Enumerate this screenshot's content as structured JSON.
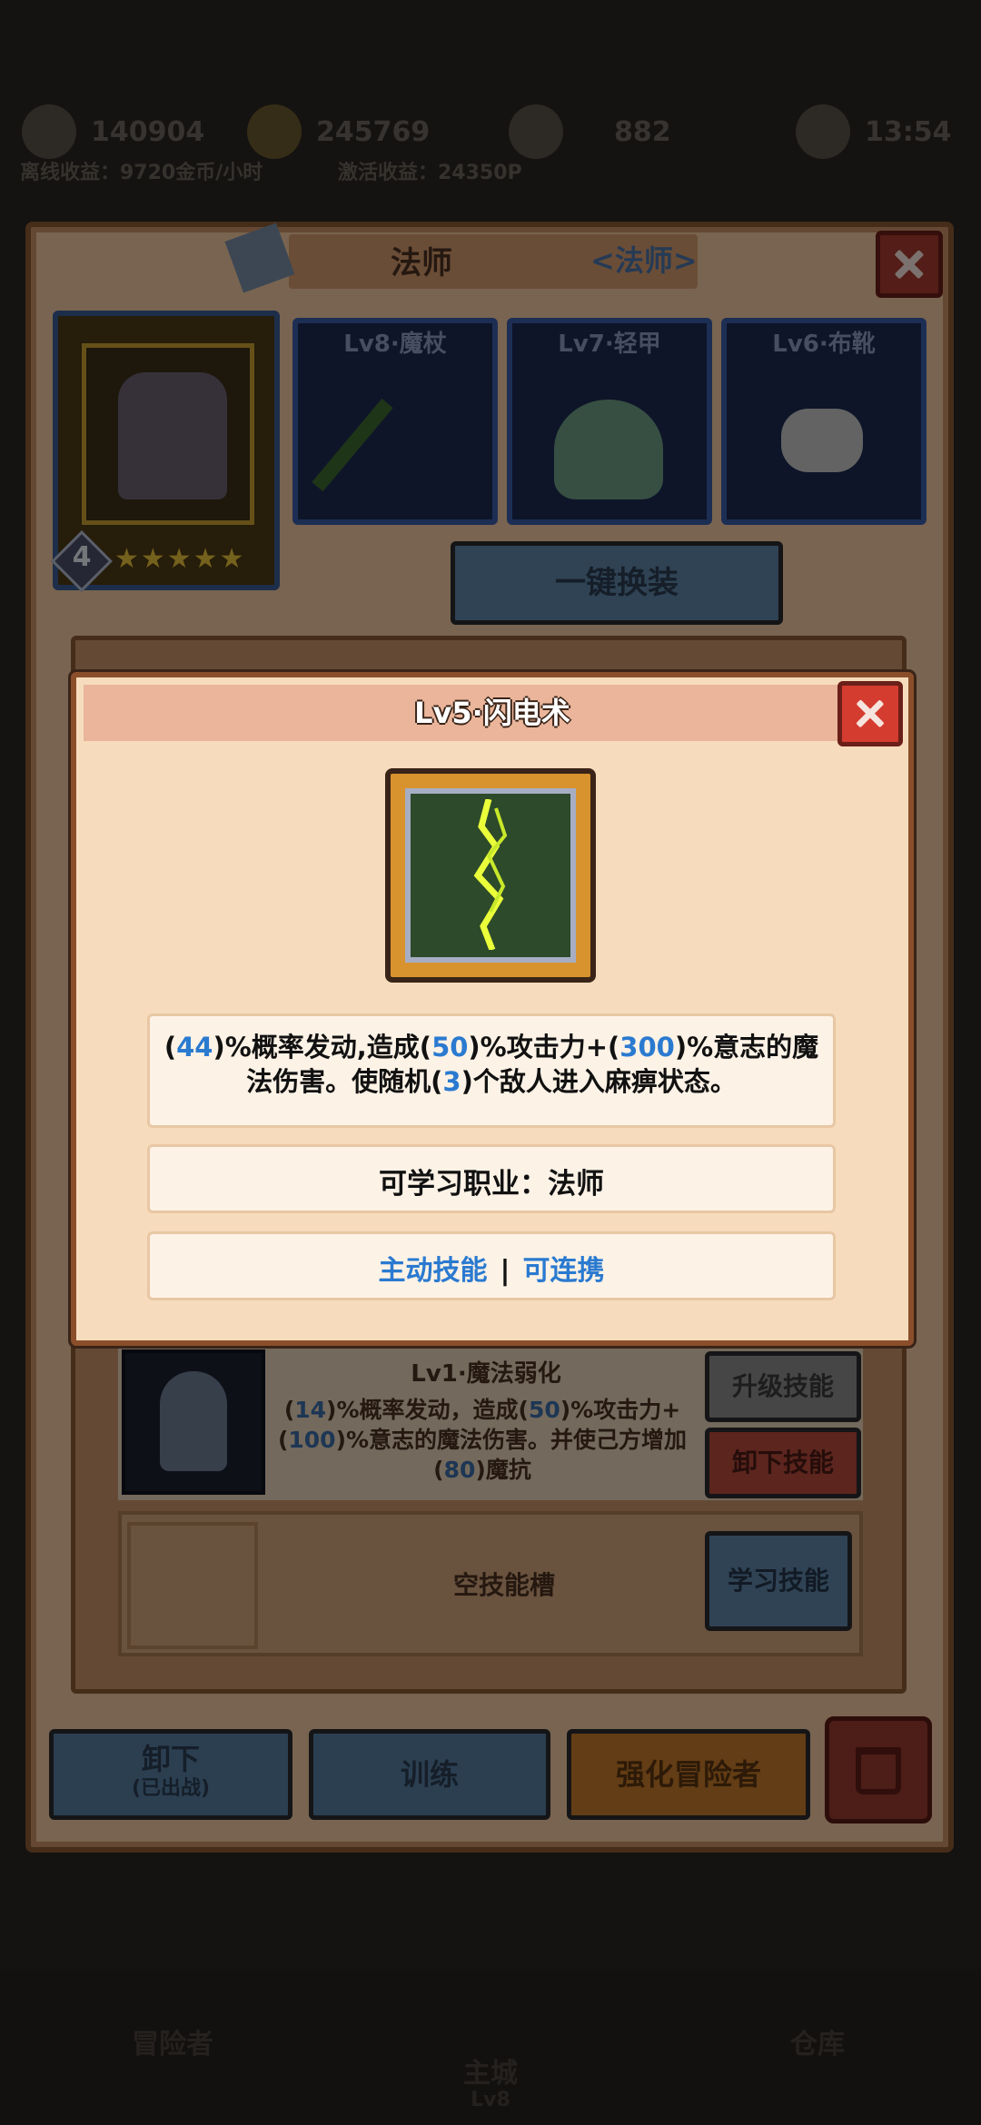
{
  "topbar": {
    "res1_value": "140904",
    "gold_value": "245769",
    "gem_value": "882",
    "time_value": "13:54",
    "income_left": "离线收益：9720金币/小时",
    "income_right": "激活收益：24350P"
  },
  "hero": {
    "name": "法师",
    "class_label": "<法师>",
    "level": "4",
    "stars": "★★★★★"
  },
  "equipment": [
    {
      "label": "Lv8·魔杖",
      "icon": "staff-icon"
    },
    {
      "label": "Lv7·轻甲",
      "icon": "light-armor-icon"
    },
    {
      "label": "Lv6·布靴",
      "icon": "cloth-boots-icon"
    }
  ],
  "buttons": {
    "equip_all": "一键换装",
    "upgrade_skill": "升级技能",
    "remove_skill": "卸下技能",
    "learn_skill": "学习技能",
    "unequip": "卸下",
    "unequip_sub": "(已出战)",
    "train": "训练",
    "enhance": "强化冒险者"
  },
  "skill_list": {
    "skill2_title": "Lv1·魔法弱化",
    "skill2_desc": {
      "p1": "(",
      "v1": "14",
      "p2": ")%概率发动，造成(",
      "v2": "50",
      "p3": ")%攻击力+(",
      "v3": "100",
      "p4": ")%意志的魔法伤害。并使己方增加(",
      "v4": "80",
      "p5": ")魔抗"
    },
    "empty_slot": "空技能槽"
  },
  "dialog": {
    "title": "Lv5·闪电术",
    "icon": "lightning-skill-icon",
    "desc": {
      "p1": "(",
      "v1": "44",
      "p2": ")%概率发动,造成(",
      "v2": "50",
      "p3": ")%攻击力+(",
      "v3": "300",
      "p4": ")%意志的魔法伤害。使随机(",
      "v4": "3",
      "p5": ")个敌人进入麻痹状态。"
    },
    "learnable_class": "可学习职业：法师",
    "tag_active": "主动技能",
    "tag_sep": "|",
    "tag_combo": "可连携"
  },
  "bottom_nav": {
    "adventurer": "冒险者",
    "main_city": "主城",
    "main_city_level": "Lv8",
    "warehouse": "仓库"
  },
  "colors": {
    "highlight_blue": "#2a7ad0",
    "panel_bg": "#f0c8a0",
    "close_red": "#d53c30"
  }
}
